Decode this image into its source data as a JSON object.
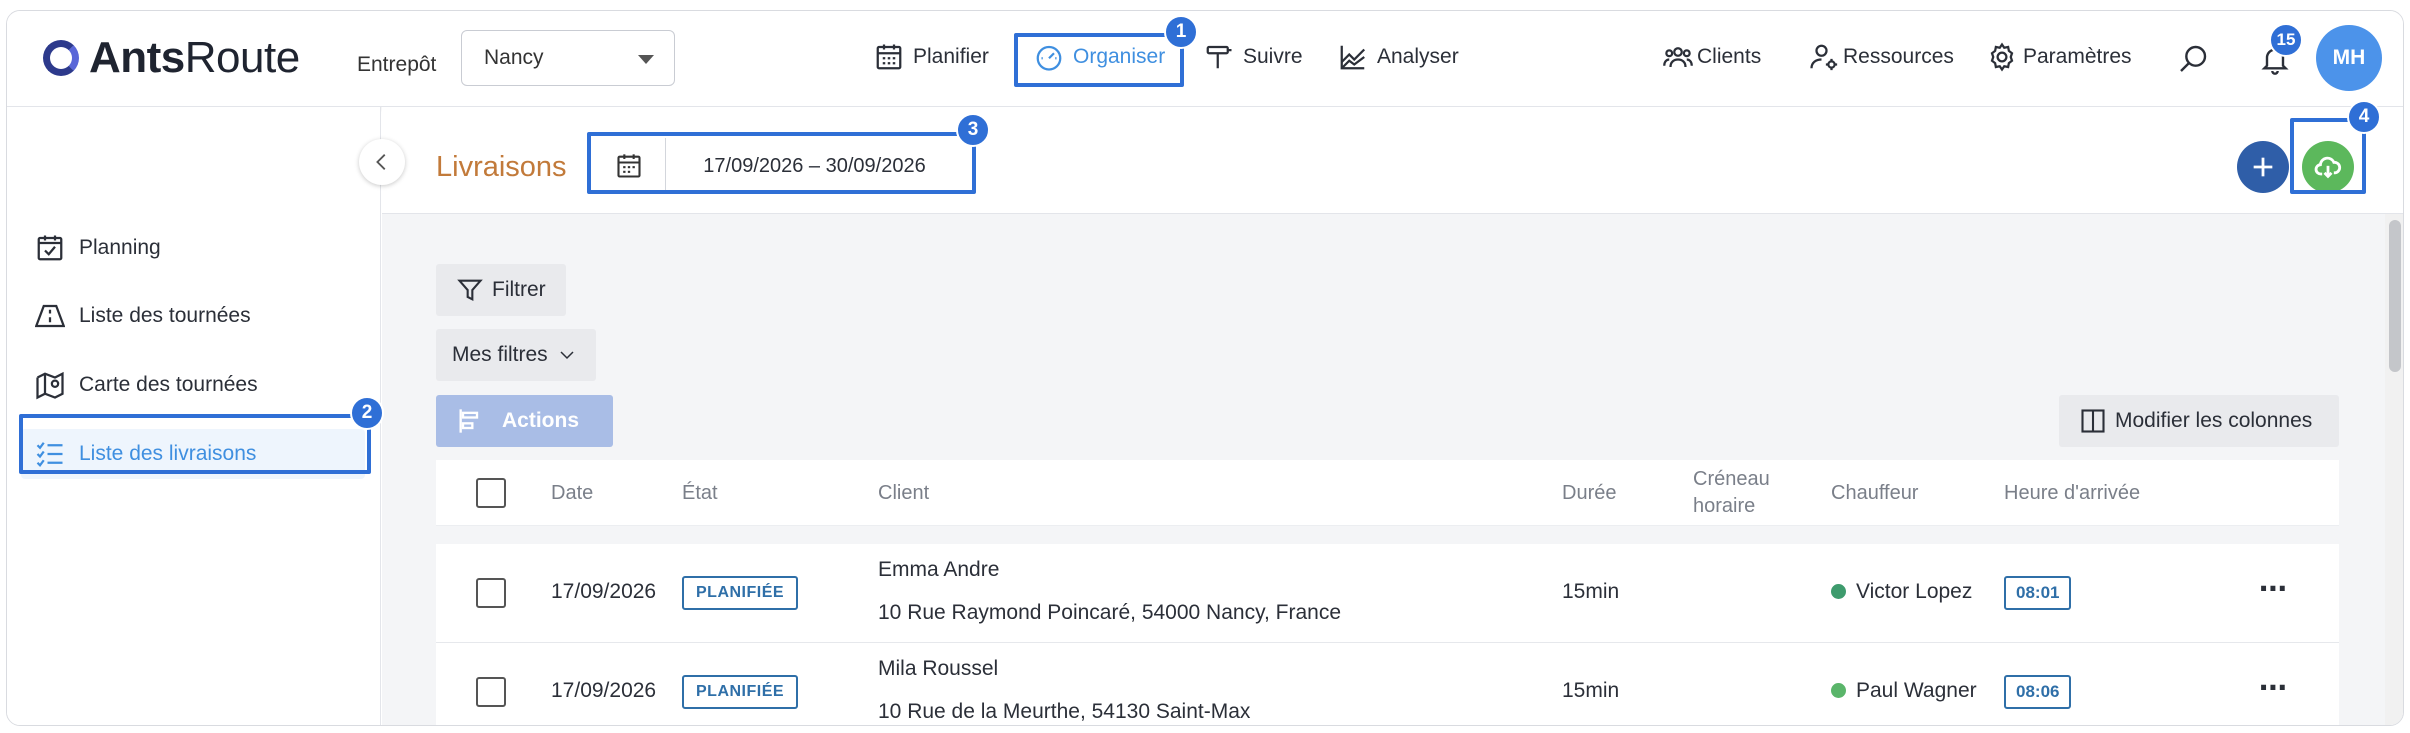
{
  "app": {
    "logo_bold": "Ants",
    "logo_light": "Route"
  },
  "warehouse": {
    "label": "Entrepôt",
    "value": "Nancy"
  },
  "nav": {
    "planifier": "Planifier",
    "organiser": "Organiser",
    "suivre": "Suivre",
    "analyser": "Analyser",
    "clients": "Clients",
    "ressources": "Ressources",
    "parametres": "Paramètres"
  },
  "notifications": {
    "count": "15"
  },
  "user": {
    "initials": "MH"
  },
  "sidebar": {
    "items": [
      {
        "label": "Planning"
      },
      {
        "label": "Liste des tournées"
      },
      {
        "label": "Carte des tournées"
      },
      {
        "label": "Liste des livraisons"
      }
    ]
  },
  "header": {
    "title": "Livraisons",
    "date_range": "17/09/2026 – 30/09/2026"
  },
  "toolbar": {
    "filter": "Filtrer",
    "my_filters": "Mes filtres",
    "actions": "Actions",
    "columns": "Modifier les colonnes"
  },
  "table": {
    "columns": {
      "date": "Date",
      "etat": "État",
      "client": "Client",
      "duree": "Durée",
      "creneau_1": "Créneau",
      "creneau_2": "horaire",
      "chauffeur": "Chauffeur",
      "heure": "Heure d'arrivée"
    },
    "rows": [
      {
        "date": "17/09/2026",
        "status": "PLANIFIÉE",
        "client_name": "Emma Andre",
        "client_address": "10 Rue Raymond Poincaré, 54000 Nancy, France",
        "duration": "15min",
        "driver": "Victor Lopez",
        "driver_color": "#3e9b6d",
        "arrival": "08:01"
      },
      {
        "date": "17/09/2026",
        "status": "PLANIFIÉE",
        "client_name": "Mila Roussel",
        "client_address": "10 Rue de la Meurthe, 54130 Saint-Max",
        "duration": "15min",
        "driver": "Paul Wagner",
        "driver_color": "#5ab56a",
        "arrival": "08:06"
      }
    ]
  },
  "annotations": [
    "1",
    "2",
    "3",
    "4"
  ],
  "colors": {
    "accent": "#3f8fe0",
    "highlight": "#2f6fd6",
    "title": "#c27a3a",
    "add_button": "#2f5ea8",
    "export_button": "#5cb85c"
  }
}
